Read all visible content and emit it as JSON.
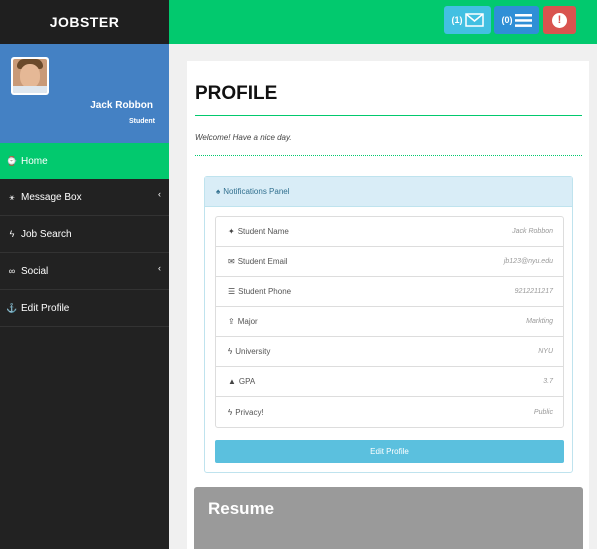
{
  "brand": "JOBSTER",
  "user": {
    "name": "Jack Robbon",
    "role": "Student"
  },
  "nav": [
    {
      "label": "Home",
      "icon": "dashboard-icon",
      "glyph": "⌚",
      "active": true,
      "chevron": ""
    },
    {
      "label": "Message Box",
      "icon": "sitemap-icon",
      "glyph": "⚹",
      "active": false,
      "chevron": "‹"
    },
    {
      "label": "Job Search",
      "icon": "bolt-icon",
      "glyph": "ϟ",
      "active": false,
      "chevron": ""
    },
    {
      "label": "Social",
      "icon": "share-icon",
      "glyph": "∞",
      "active": false,
      "chevron": "‹"
    },
    {
      "label": "Edit Profile",
      "icon": "anchor-icon",
      "glyph": "⚓",
      "active": false,
      "chevron": ""
    }
  ],
  "topbar": {
    "messages_count": "(1)",
    "tasks_count": "(0)",
    "colors": {
      "bar": "#02c96e",
      "messages": "#42c0e2",
      "tasks": "#2f8fd6",
      "alert": "#d9534f"
    }
  },
  "main": {
    "title": "PROFILE",
    "welcome": "Welcome! Have a nice day.",
    "panel_title": "Notifications Panel",
    "rows": [
      {
        "icon": "twitter-icon",
        "glyph": "✦",
        "label": "Student Name",
        "value": "Jack Robbon"
      },
      {
        "icon": "envelope-icon",
        "glyph": "✉",
        "label": "Student Email",
        "value": "jb123@nyu.edu"
      },
      {
        "icon": "tasks-icon",
        "glyph": "☰",
        "label": "Student Phone",
        "value": "9212211217"
      },
      {
        "icon": "upload-icon",
        "glyph": "⇪",
        "label": "Major",
        "value": "Markting"
      },
      {
        "icon": "bolt-icon",
        "glyph": "ϟ",
        "label": "University",
        "value": "NYU"
      },
      {
        "icon": "warning-icon",
        "glyph": "▲",
        "label": "GPA",
        "value": "3.7"
      },
      {
        "icon": "bolt-icon",
        "glyph": "ϟ",
        "label": "Privacy!",
        "value": "Public"
      }
    ],
    "edit_button": "Edit Profile",
    "resume_title": "Resume"
  }
}
